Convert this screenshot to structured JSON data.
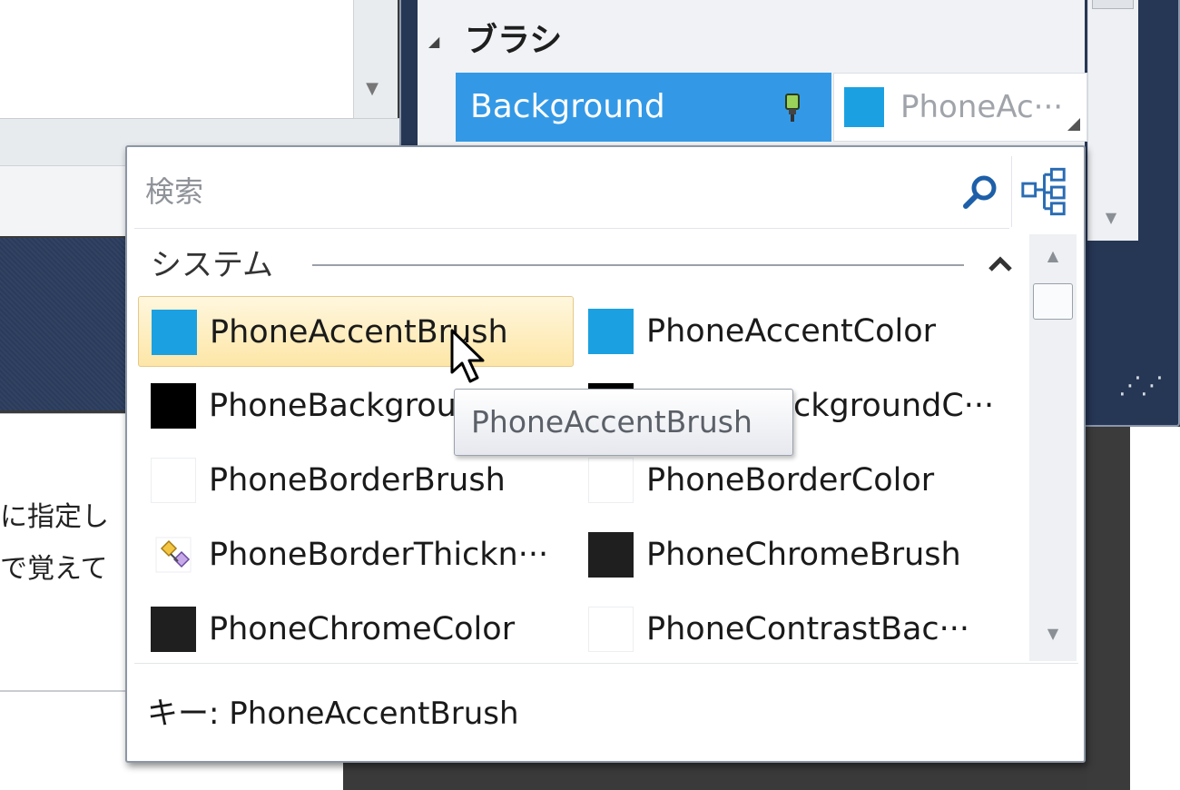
{
  "property_window": {
    "category_label": "ブラシ",
    "selected_property": "Background",
    "selected_value": "PhoneAc···",
    "value_color": "#1ba1e2"
  },
  "picker": {
    "search_placeholder": "検索",
    "section_label": "システム",
    "items": [
      {
        "label": "PhoneAccentBrush",
        "swatch": "#1ba1e2",
        "hover": true
      },
      {
        "label": "PhoneAccentColor",
        "swatch": "#1ba1e2"
      },
      {
        "label": "PhoneBackgrou",
        "swatch": "#000000"
      },
      {
        "label": "ckgroundC···",
        "swatch": "#000000"
      },
      {
        "label": "PhoneBorderBrush",
        "swatch": "#ffffff"
      },
      {
        "label": "PhoneBorderColor",
        "swatch": "#ffffff"
      },
      {
        "label": "PhoneBorderThickn···",
        "swatch": "thickness-icon"
      },
      {
        "label": "PhoneChromeBrush",
        "swatch": "#1f1f1f"
      },
      {
        "label": "PhoneChromeColor",
        "swatch": "#1f1f1f"
      },
      {
        "label": "PhoneContrastBac···",
        "swatch": "#ffffff"
      }
    ],
    "tooltip": "PhoneAccentBrush",
    "footer": "キー:  PhoneAccentBrush"
  },
  "background_doc": {
    "line1": "に指定し",
    "line2": "で覚えて"
  }
}
